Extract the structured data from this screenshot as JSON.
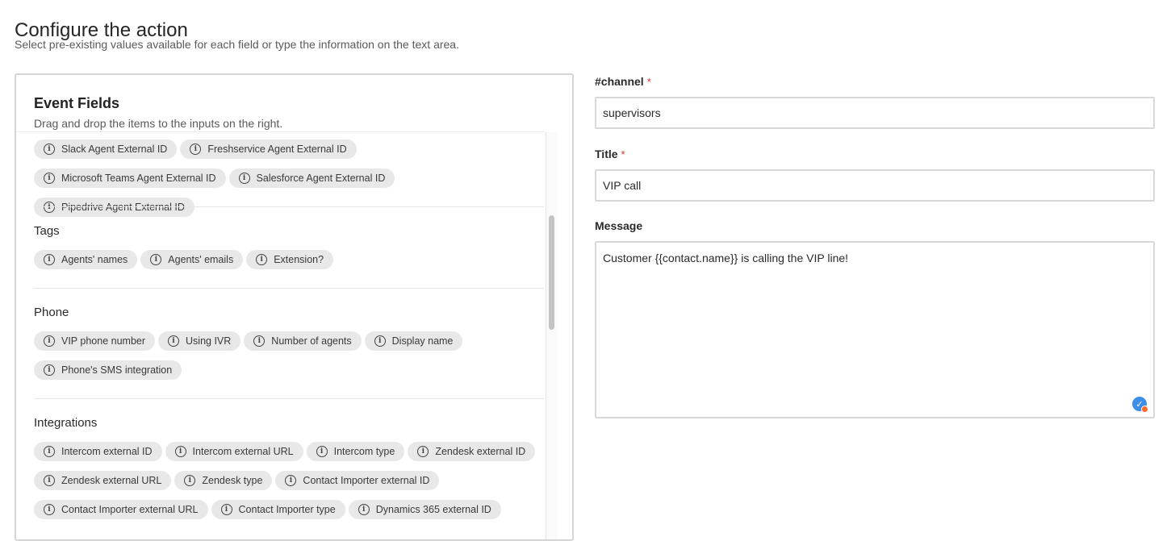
{
  "header": {
    "title": "Configure the action",
    "subtitle": "Select pre-existing values available for each field or type the information on the text area."
  },
  "event_fields": {
    "title": "Event Fields",
    "subtitle": "Drag and drop the items to the inputs on the right.",
    "groups": [
      {
        "title": "",
        "items": [
          "Slack Agent External ID",
          "Freshservice Agent External ID",
          "Microsoft Teams Agent External ID",
          "Salesforce Agent External ID",
          "Pipedrive Agent External ID"
        ]
      },
      {
        "title": "Tags",
        "items": [
          "Agents' names",
          "Agents' emails",
          "Extension?"
        ]
      },
      {
        "title": "Phone",
        "items": [
          "VIP phone number",
          "Using IVR",
          "Number of agents",
          "Display name",
          "Phone's SMS integration"
        ]
      },
      {
        "title": "Integrations",
        "items": [
          "Intercom external ID",
          "Intercom external URL",
          "Intercom type",
          "Zendesk external ID",
          "Zendesk external URL",
          "Zendesk type",
          "Contact Importer external ID",
          "Contact Importer external URL",
          "Contact Importer type",
          "Dynamics 365 external ID"
        ]
      }
    ],
    "icon": "info-icon",
    "icon_glyph": "i"
  },
  "form": {
    "channel": {
      "label": "#channel",
      "required_mark": "*",
      "value": "supervisors"
    },
    "title": {
      "label": "Title",
      "required_mark": "*",
      "value": "VIP call"
    },
    "message": {
      "label": "Message",
      "value": "Customer {{contact.name}} is calling the VIP line!"
    },
    "grammar_badge_icon": "grammar-check-icon"
  },
  "colors": {
    "chip_bg": "#e8e8e8",
    "required": "#dd3333",
    "badge": "#3d8ee8"
  }
}
